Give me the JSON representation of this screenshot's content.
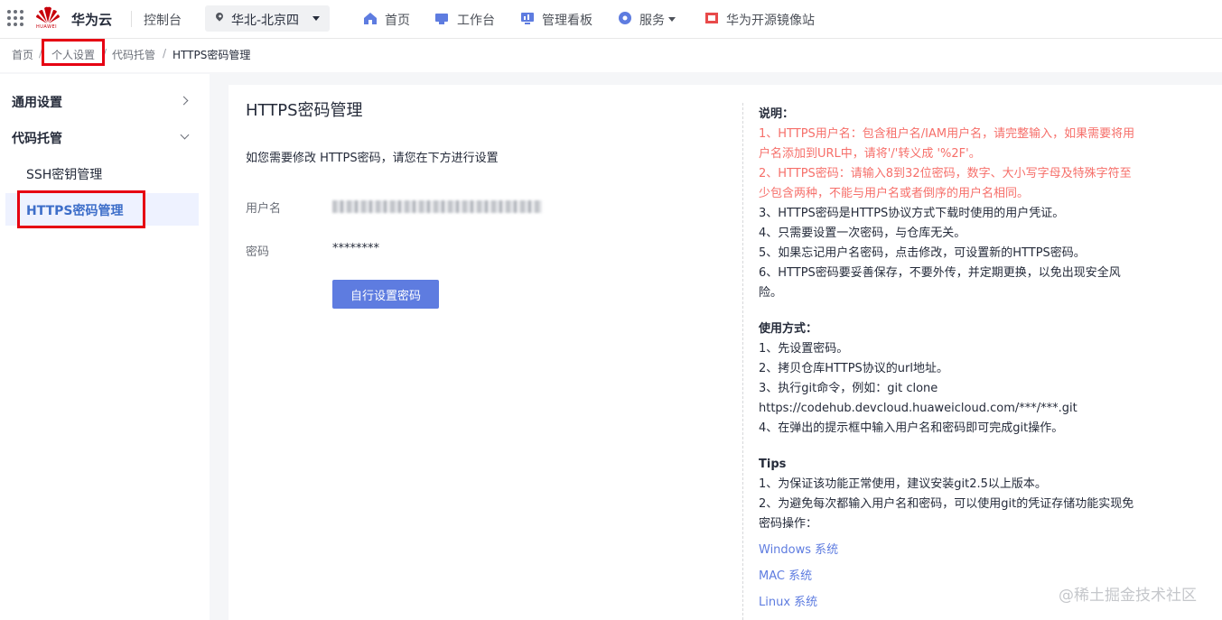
{
  "topbar": {
    "logo_text": "HUAWEI",
    "brand": "华为云",
    "console": "控制台",
    "region": "华北-北京四",
    "nav": [
      {
        "label": "首页",
        "icon": "home-icon"
      },
      {
        "label": "工作台",
        "icon": "workbench-icon"
      },
      {
        "label": "管理看板",
        "icon": "dashboard-icon"
      },
      {
        "label": "服务",
        "icon": "services-icon"
      },
      {
        "label": "华为开源镜像站",
        "icon": "mirror-icon"
      }
    ]
  },
  "breadcrumb": {
    "items": [
      "首页",
      "个人设置",
      "代码托管"
    ],
    "separator": "/",
    "current": "HTTPS密码管理"
  },
  "sidebar": {
    "groups": [
      {
        "label": "通用设置"
      },
      {
        "label": "代码托管"
      }
    ],
    "items": [
      "SSH密钥管理",
      "HTTPS密码管理"
    ]
  },
  "main": {
    "title": "HTTPS密码管理",
    "intro": "如您需要修改 HTTPS密码，请您在下方进行设置",
    "username_label": "用户名",
    "password_label": "密码",
    "password_value": "********",
    "set_button": "自行设置密码"
  },
  "notes": {
    "heading": "说明：",
    "lines": [
      "1、HTTPS用户名：包含租户名/IAM用户名，请完整输入，如果需要将用户名添加到URL中，请将'/'转义成 '%2F'。",
      "2、HTTPS密码：请输入8到32位密码，数字、大小写字母及特殊字符至少包含两种，不能与用户名或者倒序的用户名相同。",
      "3、HTTPS密码是HTTPS协议方式下载时使用的用户凭证。",
      "4、只需要设置一次密码，与仓库无关。",
      "5、如果忘记用户名密码，点击修改，可设置新的HTTPS密码。",
      "6、HTTPS密码要妥善保存，不要外传，并定期更换，以免出现安全风险。"
    ],
    "usage_heading": "使用方式：",
    "usage": [
      "1、先设置密码。",
      "2、拷贝仓库HTTPS协议的url地址。",
      "3、执行git命令，例如：git clone https://codehub.devcloud.huaweicloud.com/***/***.git",
      "4、在弹出的提示框中输入用户名和密码即可完成git操作。"
    ],
    "tips_heading": "Tips",
    "tips": [
      "1、为保证该功能正常使用，建议安装git2.5以上版本。",
      "2、为避免每次都输入用户名和密码，可以使用git的凭证存储功能实现免密码操作："
    ],
    "links": [
      "Windows 系统",
      "MAC 系统",
      "Linux 系统"
    ]
  },
  "watermark": "@稀土掘金技术社区",
  "colors": {
    "accent": "#5e7ce0",
    "warning_text": "#f66f6a",
    "highlight_box": "#e60012",
    "brand_red": "#c7000b"
  }
}
